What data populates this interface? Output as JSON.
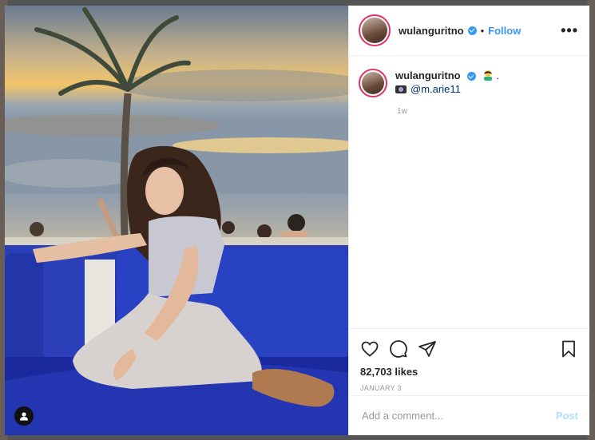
{
  "post": {
    "username": "wulanguritno",
    "follow_label": "Follow",
    "separator": "•",
    "more_label": "•••",
    "caption_username": "wulanguritno",
    "caption_trailing": ".",
    "caption_mention": "@m.arie11",
    "caption_time": "1w",
    "likes": "82,703 likes",
    "date": "JANUARY 3",
    "comment_placeholder": "Add a comment...",
    "post_label": "Post"
  },
  "colors": {
    "accent": "#3897f0",
    "story_ring": "#e1306c",
    "post_disabled": "#b2dffc"
  }
}
